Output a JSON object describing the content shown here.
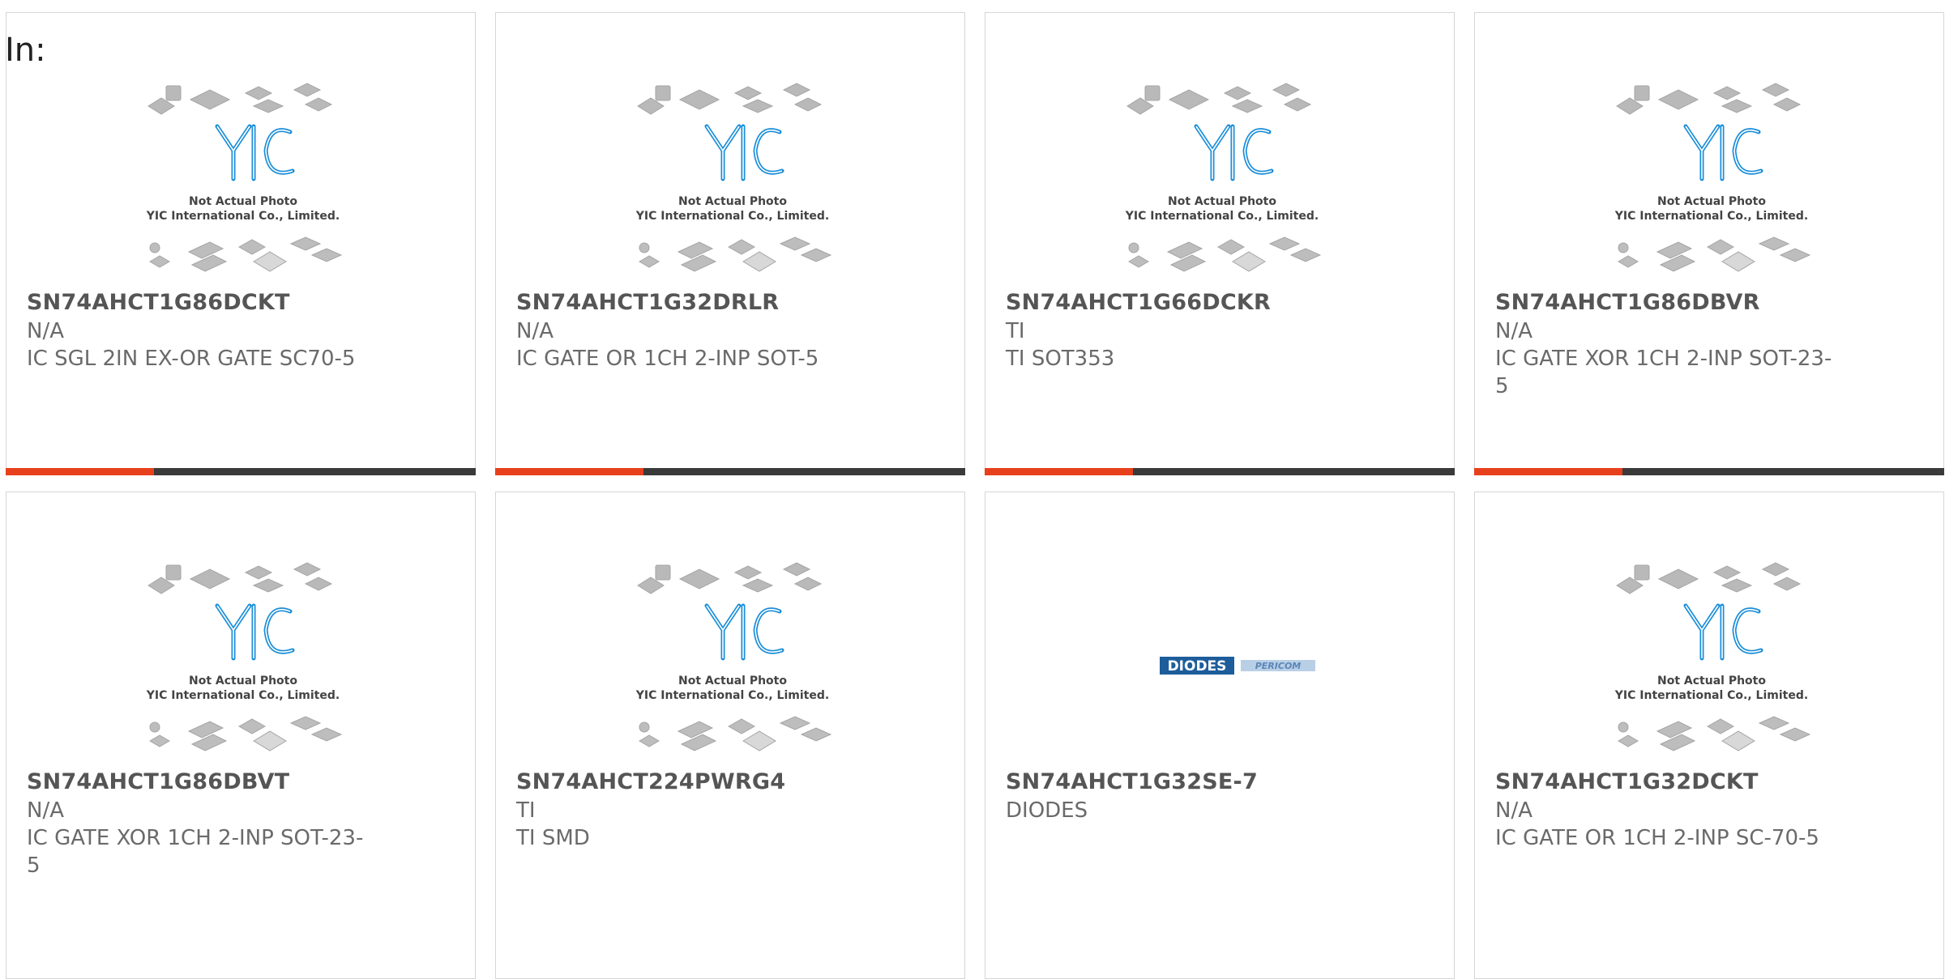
{
  "header": {
    "in_label": "In:"
  },
  "placeholder": {
    "caption1": "Not Actual Photo",
    "caption2": "YIC International Co., Limited.",
    "logo_text": "YIC"
  },
  "diodes_logo": {
    "brand": "DIODES",
    "sub": "PERICOM"
  },
  "colors": {
    "accent": "#e8401c",
    "bar": "#3a3a3a",
    "logo_blue": "#1b8ed8"
  },
  "products": [
    {
      "part": "SN74AHCT1G86DCKT",
      "mfr": "N/A",
      "desc": "IC SGL 2IN EX-OR GATE SC70-5"
    },
    {
      "part": "SN74AHCT1G32DRLR",
      "mfr": "N/A",
      "desc": "IC GATE OR 1CH 2-INP SOT-5"
    },
    {
      "part": "SN74AHCT1G66DCKR",
      "mfr": "TI",
      "desc": "TI SOT353"
    },
    {
      "part": "SN74AHCT1G86DBVR",
      "mfr": "N/A",
      "desc": "IC GATE XOR 1CH 2-INP SOT-23-5"
    },
    {
      "part": "SN74AHCT1G86DBVT",
      "mfr": "N/A",
      "desc": "IC GATE XOR 1CH 2-INP SOT-23-5"
    },
    {
      "part": "SN74AHCT224PWRG4",
      "mfr": "TI",
      "desc": "TI SMD"
    },
    {
      "part": "SN74AHCT1G32SE-7",
      "mfr": "DIODES",
      "desc": ""
    },
    {
      "part": "SN74AHCT1G32DCKT",
      "mfr": "N/A",
      "desc": "IC GATE OR 1CH 2-INP SC-70-5"
    }
  ]
}
